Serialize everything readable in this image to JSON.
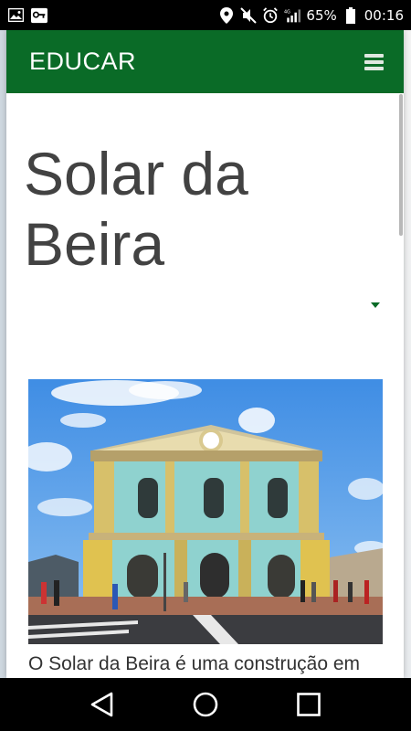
{
  "status_bar": {
    "battery_percent": "65%",
    "time": "00:16",
    "network": "4G",
    "icons": [
      "image-icon",
      "vpn-key-icon",
      "location-icon",
      "mute-icon",
      "alarm-icon",
      "signal-icon",
      "battery-icon"
    ]
  },
  "header": {
    "brand": "EDUCAR",
    "menu_icon": "hamburger-menu-icon",
    "color": "#0a6b27"
  },
  "article": {
    "title": "Solar da Beira",
    "photo_alt": "Solar da Beira building",
    "body_start": "O Solar da Beira é uma construção em"
  },
  "nav_bar": {
    "icons": [
      "back-icon",
      "home-icon",
      "recents-icon"
    ]
  }
}
